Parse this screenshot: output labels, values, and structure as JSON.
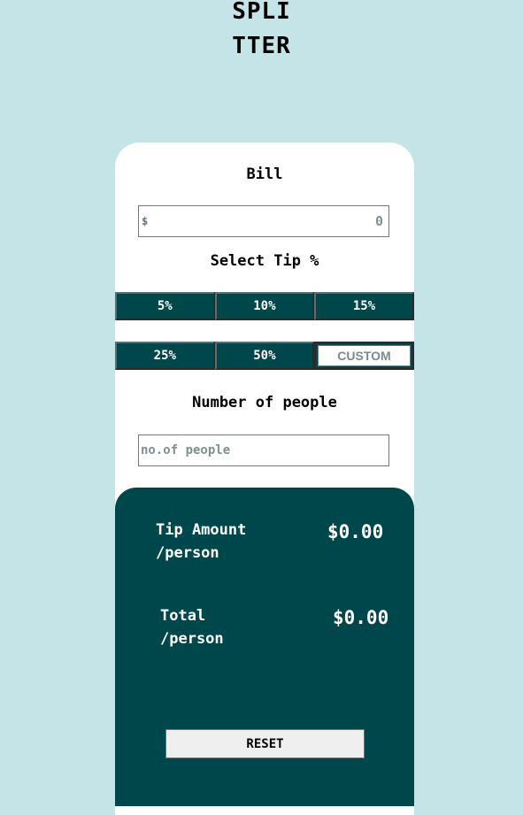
{
  "logo": {
    "line1": "SPLI",
    "line2": "TTER"
  },
  "bill": {
    "label": "Bill",
    "currency_symbol": "$",
    "value": "",
    "placeholder": "0"
  },
  "tip": {
    "label": "Select Tip %",
    "options": [
      "5%",
      "10%",
      "15%",
      "25%",
      "50%"
    ],
    "custom_placeholder": "CUSTOM"
  },
  "people": {
    "label": "Number of people",
    "value": "",
    "placeholder": "no.of people"
  },
  "result": {
    "tip_amount": {
      "label_line1": "Tip Amount",
      "label_line2": "/person",
      "value": "$0.00"
    },
    "total": {
      "label_line1": "Total",
      "label_line2": "/person",
      "value": "$0.00"
    },
    "reset_label": "RESET"
  },
  "colors": {
    "background": "#c5e4e7",
    "card": "#ffffff",
    "accent_dark": "#00474b",
    "text": "#000000"
  }
}
